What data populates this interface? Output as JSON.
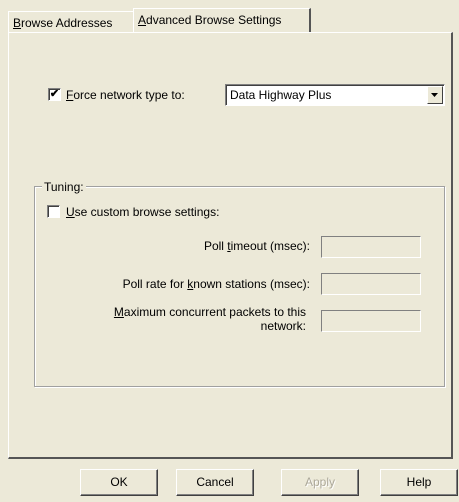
{
  "tabs": [
    {
      "label_pre": "",
      "label_ul": "B",
      "label_post": "rowse Addresses"
    },
    {
      "label_pre": "",
      "label_ul": "A",
      "label_post": "dvanced Browse Settings"
    }
  ],
  "force_network": {
    "checked": true,
    "check_glyph": "✔",
    "label_pre": "",
    "label_ul": "F",
    "label_post": "orce network type to:",
    "selected_value": "Data Highway Plus"
  },
  "tuning": {
    "legend": "Tuning:",
    "custom": {
      "checked": false,
      "label_pre": "",
      "label_ul": "U",
      "label_post": "se custom browse settings:"
    },
    "poll_timeout": {
      "label_pre": "Poll ",
      "label_ul": "t",
      "label_post": "imeout (msec):",
      "value": ""
    },
    "poll_rate": {
      "label_pre": "Poll rate for ",
      "label_ul": "k",
      "label_post": "nown stations (msec):",
      "value": ""
    },
    "max_packets": {
      "label_line1_pre": "",
      "label_line1_ul": "M",
      "label_line1_post": "aximum concurrent packets to this",
      "label_line2": "network:",
      "value": ""
    }
  },
  "buttons": {
    "ok": "OK",
    "cancel": "Cancel",
    "apply": "Apply",
    "help": "Help"
  }
}
